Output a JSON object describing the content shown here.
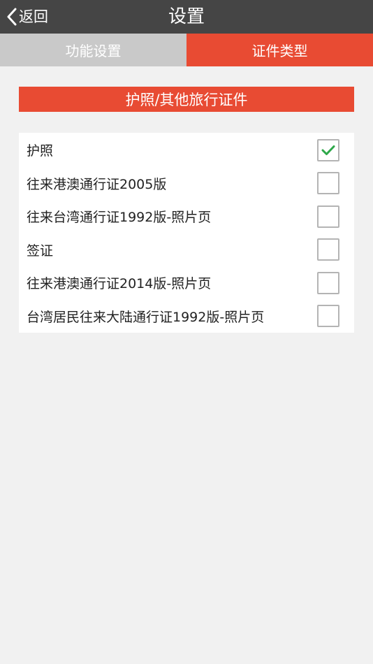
{
  "header": {
    "back_label": "返回",
    "title": "设置"
  },
  "tabs": [
    {
      "label": "功能设置",
      "active": false
    },
    {
      "label": "证件类型",
      "active": true
    }
  ],
  "section": {
    "title": "护照/其他旅行证件"
  },
  "document_types": [
    {
      "label": "护照",
      "checked": true
    },
    {
      "label": "往来港澳通行证2005版",
      "checked": false
    },
    {
      "label": "往来台湾通行证1992版-照片页",
      "checked": false
    },
    {
      "label": "签证",
      "checked": false
    },
    {
      "label": "往来港澳通行证2014版-照片页",
      "checked": false
    },
    {
      "label": "台湾居民往来大陆通行证1992版-照片页",
      "checked": false
    }
  ],
  "colors": {
    "accent": "#e84b33",
    "topbar": "#454545",
    "tab_inactive": "#c9c9c9",
    "check_green": "#2ea84a"
  },
  "icons": {
    "back": "chevron-left-icon",
    "check": "checkmark-icon"
  }
}
